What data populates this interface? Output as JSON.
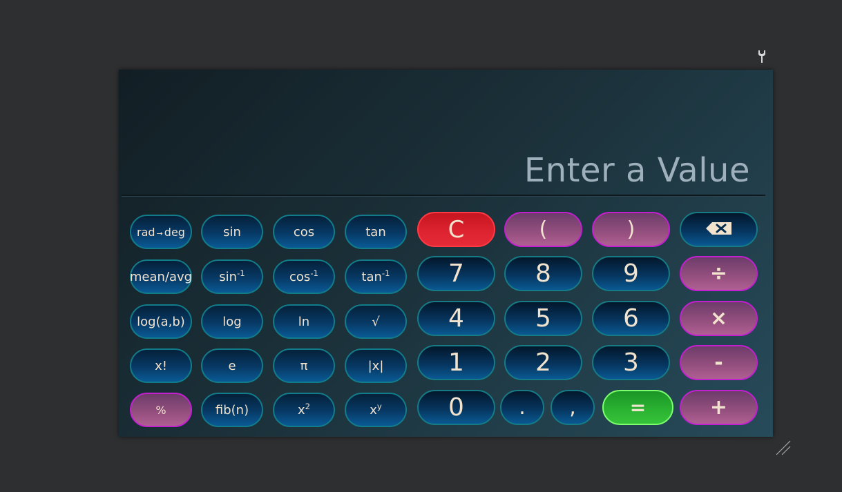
{
  "display": {
    "text": "Enter a Value"
  },
  "scientific_buttons": {
    "rad_deg": {
      "base": "rad",
      "arrow": "→",
      "tail": "deg"
    },
    "sin": "sin",
    "cos": "cos",
    "tan": "tan",
    "mean": "mean/avg",
    "asin": {
      "base": "sin",
      "sup": "-1"
    },
    "acos": {
      "base": "cos",
      "sup": "-1"
    },
    "atan": {
      "base": "tan",
      "sup": "-1"
    },
    "log_ab": "log(a,b)",
    "log": "log",
    "ln": "ln",
    "sqrt": "√",
    "factorial": "x!",
    "e": "e",
    "pi": "π",
    "abs": "|x|",
    "percent": "%",
    "fib": "fib(n)",
    "square": {
      "base": "x",
      "sup": "2"
    },
    "power": {
      "base": "x",
      "sup": "y"
    }
  },
  "keypad": {
    "clear": "C",
    "open_paren": "(",
    "close_paren": ")",
    "seven": "7",
    "eight": "8",
    "nine": "9",
    "four": "4",
    "five": "5",
    "six": "6",
    "one": "1",
    "two": "2",
    "three": "3",
    "zero": "0",
    "dot": ".",
    "comma": ",",
    "equals": "=",
    "divide": "÷",
    "multiply": "×",
    "subtract": "-",
    "add": "+"
  },
  "colors": {
    "page_bg": "#2e2f31",
    "number_border": "#157c86",
    "operator_border": "#c31fd0",
    "clear_red": "#de2430",
    "equals_green": "#2bb432",
    "key_text": "#f2e3cf",
    "display_text": "#9fb0bd"
  },
  "icons": {
    "settings": "wrench-icon",
    "backspace": "backspace-icon",
    "resize": "resize-grip-icon"
  }
}
